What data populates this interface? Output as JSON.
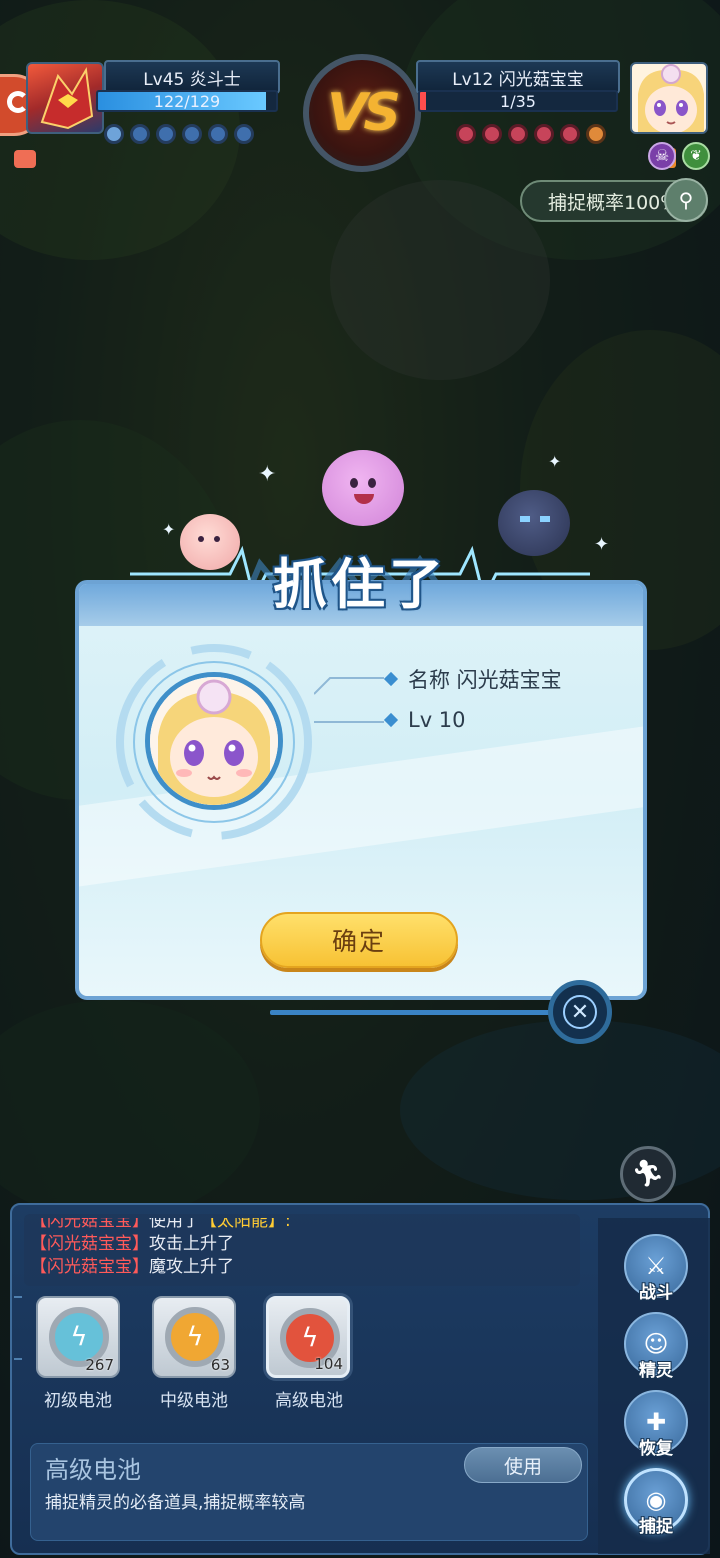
{
  "player": {
    "name_level": "Lv45 炎斗士",
    "hp_text": "122/129",
    "hp_fraction": 0.946
  },
  "enemy": {
    "name_level": "Lv12 闪光菇宝宝",
    "hp_text": "1/35",
    "hp_fraction": 0.03
  },
  "vs_label": "VS",
  "catch_chip": {
    "label": "捕捉概率100%"
  },
  "dialog": {
    "title": "抓住了",
    "name_row": "名称 闪光菇宝宝",
    "level_row": "Lv 10",
    "confirm_label": "确定"
  },
  "log": {
    "rows": [
      {
        "who": "【闪光菇宝宝】",
        "action": "使用了",
        "extra": "【太阳能】:"
      },
      {
        "who": "【闪光菇宝宝】",
        "action": "攻击上升了",
        "extra": ""
      },
      {
        "who": "【闪光菇宝宝】",
        "action": "魔攻上升了",
        "extra": ""
      }
    ]
  },
  "items": [
    {
      "label": "初级电池",
      "count": "267",
      "color": "#66c1d9"
    },
    {
      "label": "中级电池",
      "count": "63",
      "color": "#f0a733"
    },
    {
      "label": "高级电池",
      "count": "104",
      "color": "#e2533d"
    }
  ],
  "selected_item": {
    "title": "高级电池",
    "description": "捕捉精灵的必备道具,捕捉概率较高",
    "use_label": "使用"
  },
  "side_menu": [
    {
      "label": "战斗",
      "icon": "sword-icon"
    },
    {
      "label": "精灵",
      "icon": "pet-icon"
    },
    {
      "label": "恢复",
      "icon": "potion-icon"
    },
    {
      "label": "捕捉",
      "icon": "capture-icon"
    }
  ],
  "colors": {
    "player_hp": "#4fb3ff",
    "enemy_hp": "#ff4d4d",
    "accent_gold": "#f4b332"
  }
}
